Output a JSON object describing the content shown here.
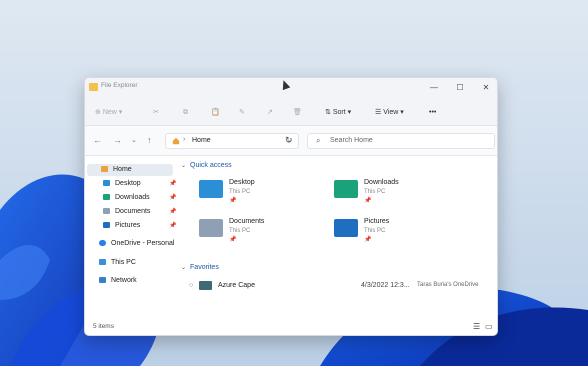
{
  "window": {
    "title": "File Explorer"
  },
  "toolbar": {
    "new_label": "New",
    "sort_label": "Sort",
    "view_label": "View",
    "more_label": "•••"
  },
  "address": {
    "path": "Home",
    "search_placeholder": "Search Home"
  },
  "sidebar": {
    "items": [
      {
        "label": "Home",
        "selected": true
      },
      {
        "label": "Desktop",
        "pinned": true
      },
      {
        "label": "Downloads",
        "pinned": true
      },
      {
        "label": "Documents",
        "pinned": true
      },
      {
        "label": "Pictures",
        "pinned": true
      },
      {
        "label": "OneDrive - Personal"
      },
      {
        "label": "This PC"
      },
      {
        "label": "Network"
      }
    ]
  },
  "quick_access": {
    "title": "Quick access",
    "items": [
      {
        "name": "Desktop",
        "location": "This PC",
        "color": "#2a8fd6"
      },
      {
        "name": "Downloads",
        "location": "This PC",
        "color": "#1aa37a"
      },
      {
        "name": "Documents",
        "location": "This PC",
        "color": "#8fa0b5"
      },
      {
        "name": "Pictures",
        "location": "This PC",
        "color": "#1e6fc0"
      }
    ]
  },
  "favorites": {
    "title": "Favorites",
    "items": [
      {
        "name": "Azure Cape",
        "date": "4/3/2022 12:3...",
        "location": "Taras Buria's OneDrive"
      }
    ]
  },
  "status": {
    "count_text": "5 items"
  },
  "colors": {
    "accent": "#1a5aa8",
    "folder": "#f2c14e"
  }
}
